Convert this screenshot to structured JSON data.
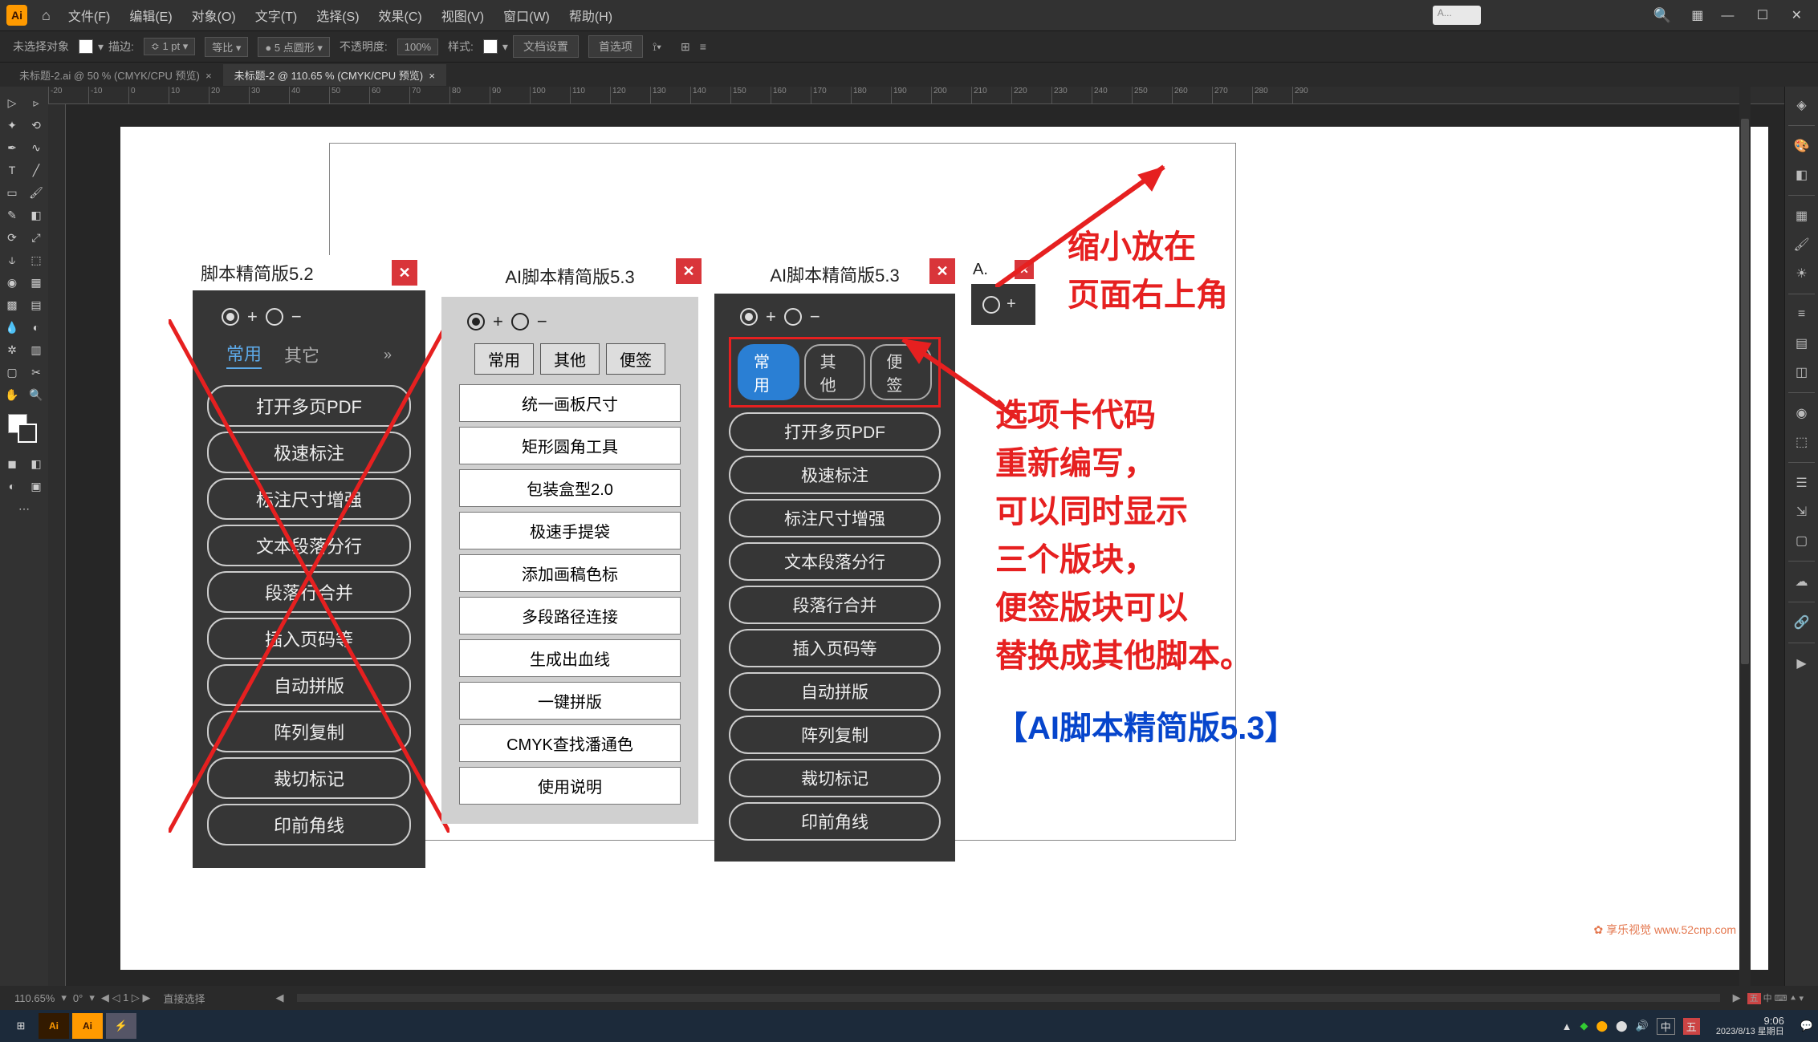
{
  "menubar": {
    "items": [
      "文件(F)",
      "编辑(E)",
      "对象(O)",
      "文字(T)",
      "选择(S)",
      "效果(C)",
      "视图(V)",
      "窗口(W)",
      "帮助(H)"
    ],
    "search_placeholder": "A..."
  },
  "controlbar": {
    "no_selection": "未选择对象",
    "stroke_label": "描边:",
    "stroke_val": "1 pt",
    "uniform": "等比",
    "pt_round": "5 点圆形",
    "opacity_label": "不透明度:",
    "opacity_val": "100%",
    "style_label": "样式:",
    "doc_setup": "文档设置",
    "prefs": "首选项"
  },
  "tabs": {
    "t1": "未标题-2.ai @ 50 % (CMYK/CPU 预览)",
    "t2": "未标题-2 @ 110.65 % (CMYK/CPU 预览)"
  },
  "ruler_values": [
    "-20",
    "-10",
    "0",
    "10",
    "20",
    "30",
    "40",
    "50",
    "60",
    "70",
    "80",
    "90",
    "100",
    "110",
    "120",
    "130",
    "140",
    "150",
    "160",
    "170",
    "180",
    "190",
    "200",
    "210",
    "220",
    "230",
    "240",
    "250",
    "260",
    "270",
    "280",
    "290"
  ],
  "panel1": {
    "title": "脚本精简版5.2",
    "tab_active": "常用",
    "tab_other": "其它",
    "buttons": [
      "打开多页PDF",
      "极速标注",
      "标注尺寸增强",
      "文本段落分行",
      "段落行合并",
      "插入页码等",
      "自动拼版",
      "阵列复制",
      "裁切标记",
      "印前角线"
    ]
  },
  "panel2": {
    "title": "AI脚本精简版5.3",
    "tabs": [
      "常用",
      "其他",
      "便签"
    ],
    "buttons": [
      "统一画板尺寸",
      "矩形圆角工具",
      "包装盒型2.0",
      "极速手提袋",
      "添加画稿色标",
      "多段路径连接",
      "生成出血线",
      "一键拼版",
      "CMYK查找潘通色",
      "使用说明"
    ]
  },
  "panel3": {
    "title": "AI脚本精简版5.3",
    "tabs": [
      "常用",
      "其他",
      "便签"
    ],
    "buttons": [
      "打开多页PDF",
      "极速标注",
      "标注尺寸增强",
      "文本段落分行",
      "段落行合并",
      "插入页码等",
      "自动拼版",
      "阵列复制",
      "裁切标记",
      "印前角线"
    ]
  },
  "panel4": {
    "title": "A."
  },
  "anno_top": "缩小放在\n页面右上角",
  "anno_mid": "选项卡代码\n重新编写，\n可以同时显示\n三个版块，\n便签版块可以\n替换成其他脚本。",
  "anno_bottom": "【AI脚本精简版5.3】",
  "statusbar": {
    "zoom": "110.65%",
    "rot": "0°",
    "artboard": "1",
    "tool": "直接选择"
  },
  "taskbar": {
    "time": "9:06",
    "date": "2023/8/13 星期日"
  },
  "tray_lang": "五",
  "tray_ime": "中",
  "watermark": "享乐视觉 www.52cnp.com"
}
